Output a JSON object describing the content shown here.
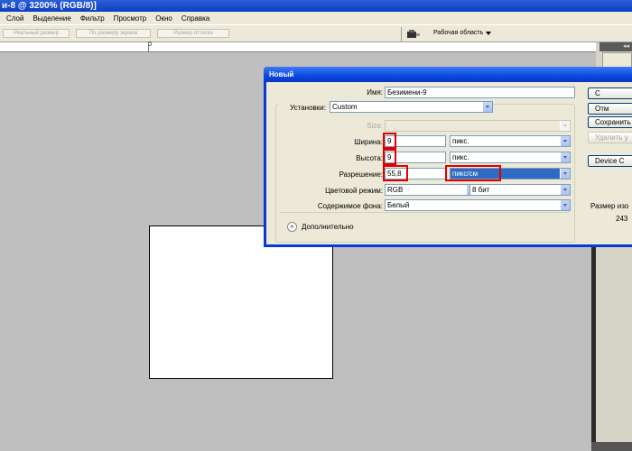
{
  "window": {
    "title": "и-8 @ 3200% (RGB/8)]"
  },
  "menu": {
    "items": [
      "Слой",
      "Выделение",
      "Фильтр",
      "Просмотр",
      "Окно",
      "Справка"
    ]
  },
  "options_bar": {
    "buttons": [
      "Реальный размер",
      "По размеру экрана",
      "Размер оттиска"
    ],
    "workspace_label": "Рабочая область"
  },
  "ruler": {
    "zero": "0"
  },
  "right_panel": {
    "collapse": "◂◂"
  },
  "dialog": {
    "title": "Новый",
    "fields": {
      "name": {
        "label": "Имя:",
        "value": "Безимени-9"
      },
      "preset": {
        "label": "Установки:",
        "value": "Custom"
      },
      "size": {
        "label": "Size:",
        "value": ""
      },
      "width": {
        "label": "Ширина:",
        "value": "9",
        "unit": "пикс."
      },
      "height": {
        "label": "Высота:",
        "value": "9",
        "unit": "пикс."
      },
      "resolution": {
        "label": "Разрешение:",
        "value": "55,8",
        "unit": "пикс/см"
      },
      "color_mode": {
        "label": "Цветовой режим:",
        "value": "RGB",
        "depth": "8 бит"
      },
      "background": {
        "label": "Содержимое фона:",
        "value": "Белый"
      }
    },
    "advanced": {
      "label": "Дополнительно",
      "icon": "chevron-down-circle-icon"
    },
    "buttons": {
      "ok": "С",
      "cancel": "Отм",
      "save_preset": "Сохранить",
      "delete_preset": "Удалить у",
      "device_central": "Device C"
    },
    "image_size": {
      "label": "Размер изо",
      "value": "243"
    }
  },
  "colors": {
    "highlight": "#e00000",
    "title_blue": "#0a49e0",
    "selection": "#316ac5"
  }
}
